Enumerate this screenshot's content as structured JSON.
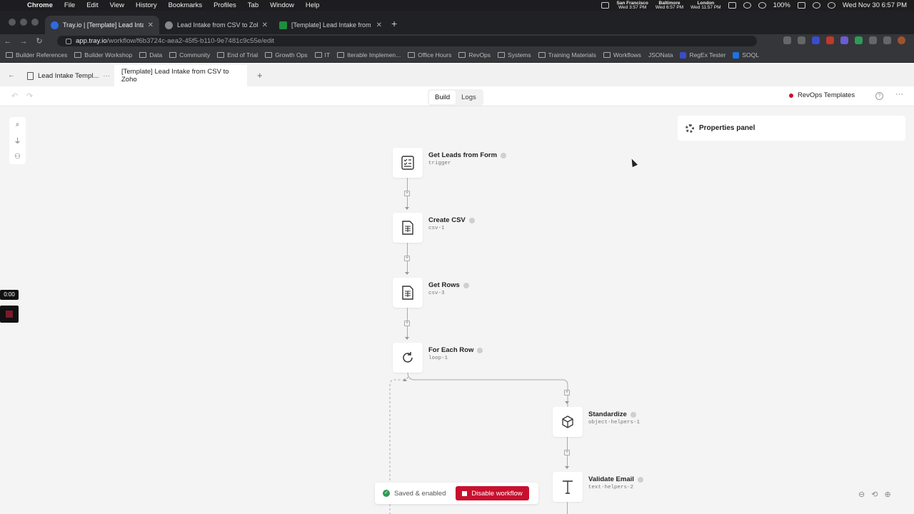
{
  "menubar": {
    "app": "Chrome",
    "items": [
      "File",
      "Edit",
      "View",
      "History",
      "Bookmarks",
      "Profiles",
      "Tab",
      "Window",
      "Help"
    ],
    "clocks": [
      {
        "city": "San Francisco",
        "time": "Wed 3:57 PM"
      },
      {
        "city": "Baltimore",
        "time": "Wed 6:57 PM"
      },
      {
        "city": "London",
        "time": "Wed 11:57 PM"
      }
    ],
    "battery": "100%",
    "datetime": "Wed Nov 30  6:57 PM"
  },
  "browser": {
    "tabs": [
      {
        "title": "Tray.io | [Template] Lead Intake",
        "favicon_color": "#2d6cdf"
      },
      {
        "title": "Lead Intake from CSV to Zoho",
        "favicon_color": "#888888"
      },
      {
        "title": "[Template] Lead Intake from C",
        "favicon_color": "#1e8e3e"
      }
    ],
    "url_host": "app.tray.io",
    "url_path": "/workflow/f6b3724c-aea2-45f5-b110-9e7481c9c55e/edit",
    "bookmarks": [
      "Builder References",
      "Builder Workshop",
      "Data",
      "Community",
      "End of Trial",
      "Growth Ops",
      "IT",
      "Iterable Implemen...",
      "Office Hours",
      "RevOps",
      "Systems",
      "Training Materials",
      "Workflows",
      "JSONata",
      "RegEx Tester",
      "SOQL"
    ]
  },
  "app": {
    "tabs": [
      {
        "label": "Lead Intake Templ..."
      },
      {
        "label": "[Template] Lead Intake from CSV to Zoho"
      }
    ],
    "modes": [
      "Build",
      "Logs"
    ],
    "project": "RevOps Templates",
    "properties_panel": "Properties panel",
    "timer": "0:00",
    "colors": {
      "accent": "#c8102e",
      "success": "#2e9b57"
    }
  },
  "steps": [
    {
      "name": "Get Leads from Form",
      "id": "trigger",
      "icon": "form-checklist-icon"
    },
    {
      "name": "Create CSV",
      "id": "csv-1",
      "icon": "csv-document-icon"
    },
    {
      "name": "Get Rows",
      "id": "csv-3",
      "icon": "csv-document-icon"
    },
    {
      "name": "For Each Row",
      "id": "loop-1",
      "icon": "loop-icon"
    },
    {
      "name": "Standardize",
      "id": "object-helpers-1",
      "icon": "cube-icon"
    },
    {
      "name": "Validate Email",
      "id": "text-helpers-2",
      "icon": "text-t-icon"
    }
  ],
  "status": {
    "text": "Saved & enabled",
    "button": "Disable workflow"
  }
}
